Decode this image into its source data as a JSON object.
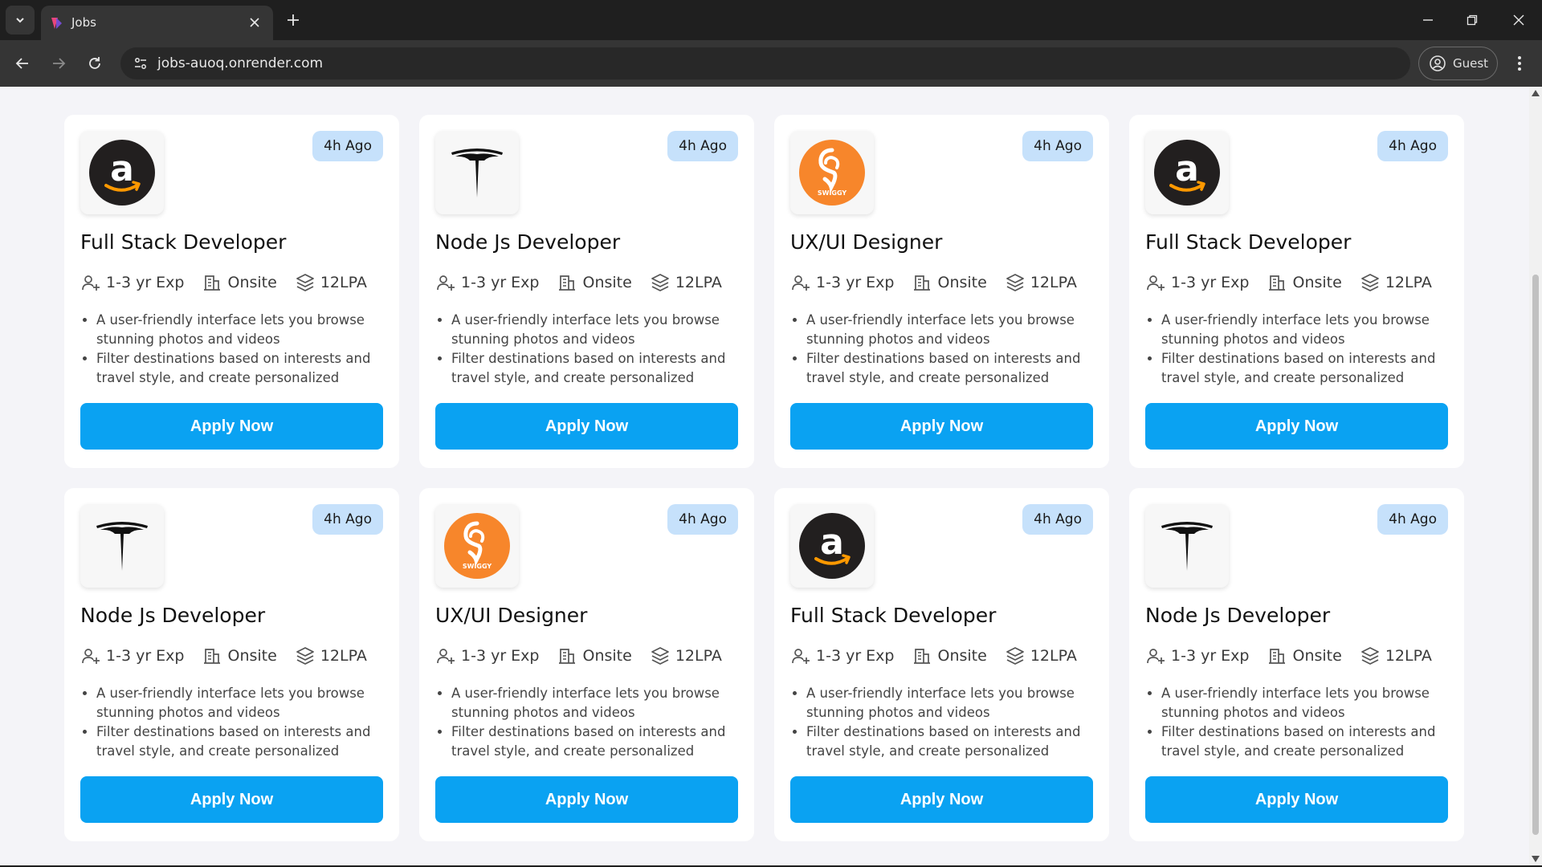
{
  "browser": {
    "tab_title": "Jobs",
    "url": "jobs-auoq.onrender.com",
    "profile_label": "Guest"
  },
  "colors": {
    "accent": "#0aa2f2",
    "badge_bg": "#c6e1fb",
    "swiggy_orange": "#f7862b",
    "amazon_dark": "#221f1f",
    "amazon_smile": "#ff9900"
  },
  "cards": [
    {
      "company_logo": "amazon-logo",
      "posted": "4h Ago",
      "title": "Full Stack Developer",
      "experience": "1-3 yr Exp",
      "location": "Onsite",
      "salary": "12LPA",
      "bullets": [
        "A user-friendly interface lets you browse stunning photos and videos",
        "Filter destinations based on interests and travel style, and create personalized"
      ],
      "apply_label": "Apply Now"
    },
    {
      "company_logo": "tesla-logo",
      "posted": "4h Ago",
      "title": "Node Js Developer",
      "experience": "1-3 yr Exp",
      "location": "Onsite",
      "salary": "12LPA",
      "bullets": [
        "A user-friendly interface lets you browse stunning photos and videos",
        "Filter destinations based on interests and travel style, and create personalized"
      ],
      "apply_label": "Apply Now"
    },
    {
      "company_logo": "swiggy-logo",
      "logo_text": "SWIGGY",
      "posted": "4h Ago",
      "title": "UX/UI Designer",
      "experience": "1-3 yr Exp",
      "location": "Onsite",
      "salary": "12LPA",
      "bullets": [
        "A user-friendly interface lets you browse stunning photos and videos",
        "Filter destinations based on interests and travel style, and create personalized"
      ],
      "apply_label": "Apply Now"
    },
    {
      "company_logo": "amazon-logo",
      "posted": "4h Ago",
      "title": "Full Stack Developer",
      "experience": "1-3 yr Exp",
      "location": "Onsite",
      "salary": "12LPA",
      "bullets": [
        "A user-friendly interface lets you browse stunning photos and videos",
        "Filter destinations based on interests and travel style, and create personalized"
      ],
      "apply_label": "Apply Now"
    },
    {
      "company_logo": "tesla-logo",
      "posted": "4h Ago",
      "title": "Node Js Developer",
      "experience": "1-3 yr Exp",
      "location": "Onsite",
      "salary": "12LPA",
      "bullets": [
        "A user-friendly interface lets you browse stunning photos and videos",
        "Filter destinations based on interests and travel style, and create personalized"
      ],
      "apply_label": "Apply Now"
    },
    {
      "company_logo": "swiggy-logo",
      "logo_text": "SWIGGY",
      "posted": "4h Ago",
      "title": "UX/UI Designer",
      "experience": "1-3 yr Exp",
      "location": "Onsite",
      "salary": "12LPA",
      "bullets": [
        "A user-friendly interface lets you browse stunning photos and videos",
        "Filter destinations based on interests and travel style, and create personalized"
      ],
      "apply_label": "Apply Now"
    },
    {
      "company_logo": "amazon-logo",
      "posted": "4h Ago",
      "title": "Full Stack Developer",
      "experience": "1-3 yr Exp",
      "location": "Onsite",
      "salary": "12LPA",
      "bullets": [
        "A user-friendly interface lets you browse stunning photos and videos",
        "Filter destinations based on interests and travel style, and create personalized"
      ],
      "apply_label": "Apply Now"
    },
    {
      "company_logo": "tesla-logo",
      "posted": "4h Ago",
      "title": "Node Js Developer",
      "experience": "1-3 yr Exp",
      "location": "Onsite",
      "salary": "12LPA",
      "bullets": [
        "A user-friendly interface lets you browse stunning photos and videos",
        "Filter destinations based on interests and travel style, and create personalized"
      ],
      "apply_label": "Apply Now"
    }
  ]
}
